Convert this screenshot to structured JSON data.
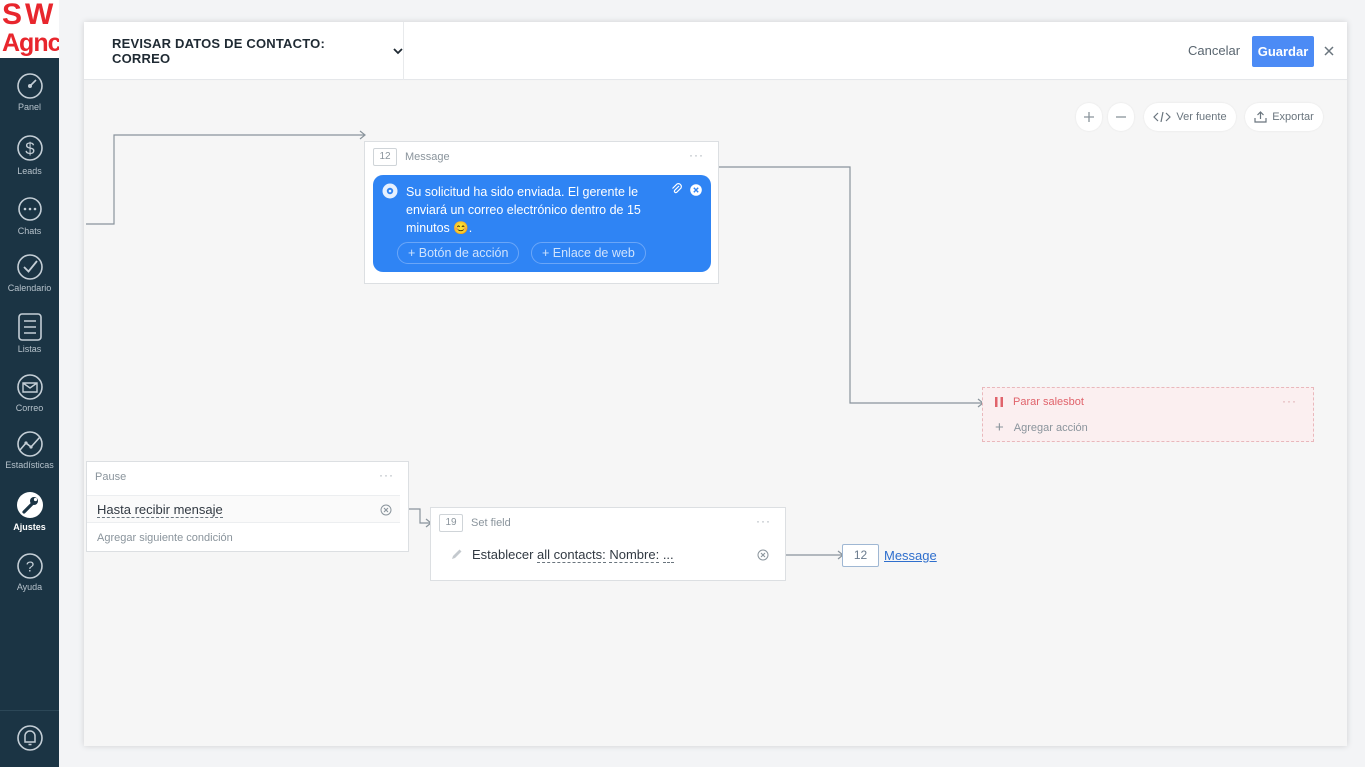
{
  "brand": {
    "line1": "SW",
    "line2": "Agnc"
  },
  "sidebar": {
    "items": [
      {
        "label": "Panel",
        "icon": "dashboard-icon"
      },
      {
        "label": "Leads",
        "icon": "dollar-icon"
      },
      {
        "label": "Chats",
        "icon": "chat-icon"
      },
      {
        "label": "Calendario",
        "icon": "check-icon"
      },
      {
        "label": "Listas",
        "icon": "list-icon"
      },
      {
        "label": "Correo",
        "icon": "mail-icon"
      },
      {
        "label": "Estadísticas",
        "icon": "stats-icon"
      },
      {
        "label": "Ajustes",
        "icon": "wrench-icon",
        "active": true
      },
      {
        "label": "Ayuda",
        "icon": "help-icon"
      }
    ]
  },
  "modal": {
    "title": "REVISAR DATOS DE CONTACTO: CORREO",
    "cancel_label": "Cancelar",
    "save_label": "Guardar"
  },
  "toolbar": {
    "view_source_label": "Ver fuente",
    "export_label": "Exportar"
  },
  "nodes": {
    "message": {
      "step": "12",
      "type": "Message",
      "more": "···",
      "text": "Su solicitud ha sido enviada. El gerente le enviará un correo electrónico dentro de 15 minutos 😊.",
      "action_button_label": "+ Botón de acción",
      "web_link_label": "+ Enlace de web"
    },
    "stop": {
      "label": "Parar salesbot",
      "more": "···",
      "add_action_label": "Agregar acción"
    },
    "pause": {
      "type": "Pause",
      "more": "···",
      "condition": "Hasta recibir mensaje",
      "add_condition_label": "Agregar siguiente condición"
    },
    "set_field": {
      "step": "19",
      "type": "Set field",
      "more": "···",
      "prefix": "Establecer ",
      "entity": "all contacts:",
      "field": "Nombre:",
      "value": "..."
    },
    "next": {
      "step": "12",
      "label": "Message"
    }
  },
  "colors": {
    "accent": "#4c8bf5",
    "bubble": "#2f84f4",
    "sidebar": "#1b3444",
    "stop": "#e0636b",
    "brand": "#e8262d"
  }
}
